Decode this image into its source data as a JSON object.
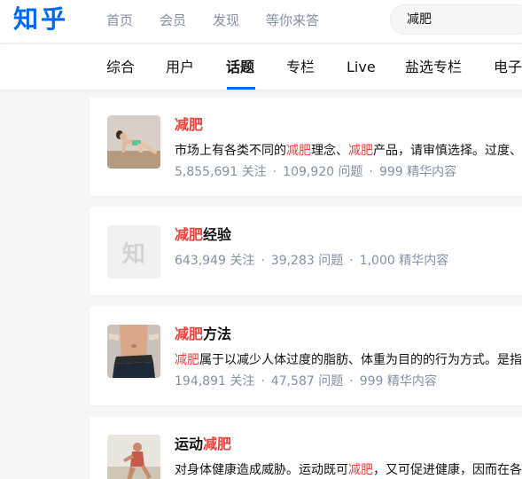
{
  "header": {
    "logo": "知乎",
    "nav": [
      "首页",
      "会员",
      "发现",
      "等你来答"
    ],
    "search_value": "减肥"
  },
  "tabs": [
    "综合",
    "用户",
    "话题",
    "专栏",
    "Live",
    "盐选专栏",
    "电子"
  ],
  "active_tab": "话题",
  "colors": {
    "brand": "#0066ff",
    "highlight": "#f1403c",
    "meta": "#8590a6"
  },
  "results": [
    {
      "title_pre": "",
      "title_hl": "减肥",
      "title_post": "",
      "desc": [
        "市场上有各类不同的",
        "减肥",
        "理念、",
        "减肥",
        "产品，请审慎选择。过度、"
      ],
      "followers": "5,855,691 关注",
      "questions": "109,920 问题",
      "essence": "999 精华内容",
      "thumb_icon": "yoga-photo"
    },
    {
      "title_pre": "",
      "title_hl": "减肥",
      "title_post": "经验",
      "thumb_text": "知",
      "followers": "643,949 关注",
      "questions": "39,283 问题",
      "essence": "1,000 精华内容",
      "thumb_icon": "zhihu-placeholder-icon"
    },
    {
      "title_pre": "",
      "title_hl": "减肥",
      "title_post": "方法",
      "desc": [
        "",
        "减肥",
        "属于以减少人体过度的脂肪、体重为目的的行为方式。是指"
      ],
      "followers": "194,891 关注",
      "questions": "47,587 问题",
      "essence": "999 精华内容",
      "thumb_icon": "waist-measure-photo"
    },
    {
      "title_pre": "运动",
      "title_hl": "减肥",
      "title_post": "",
      "desc": [
        "对身体健康造成威胁。运动既可",
        "减肥",
        "，又可促进健康，因而在各"
      ],
      "thumb_icon": "running-photo"
    }
  ]
}
